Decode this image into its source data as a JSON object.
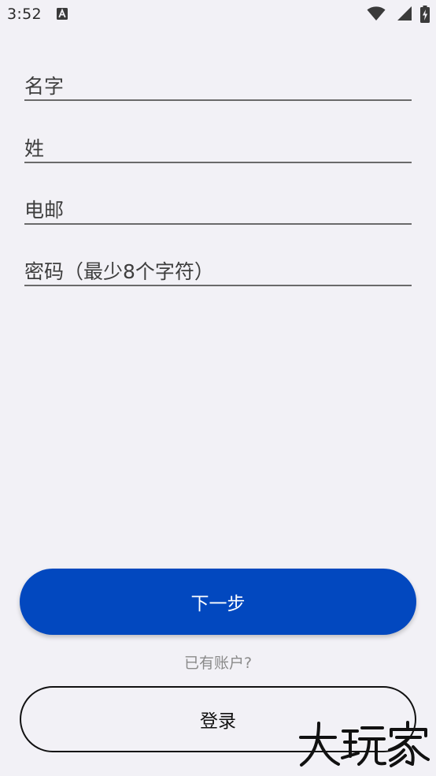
{
  "status_bar": {
    "time": "3:52",
    "notification_icon": "text-a-icon",
    "icons": [
      "wifi-icon",
      "cellular-signal-icon",
      "battery-charging-icon"
    ]
  },
  "form": {
    "first_name": {
      "placeholder": "名字",
      "value": ""
    },
    "last_name": {
      "placeholder": "姓",
      "value": ""
    },
    "email": {
      "placeholder": "电邮",
      "value": ""
    },
    "password": {
      "placeholder": "密码（最少8个字符）",
      "value": ""
    }
  },
  "actions": {
    "next_label": "下一步",
    "have_account_text": "已有账户?",
    "login_label": "登录"
  },
  "watermark": {
    "text": "大玩家"
  },
  "colors": {
    "background": "#f2f1f6",
    "primary": "#0248bf",
    "underline": "#6a6a6a",
    "muted_text": "#8a8a8a"
  }
}
